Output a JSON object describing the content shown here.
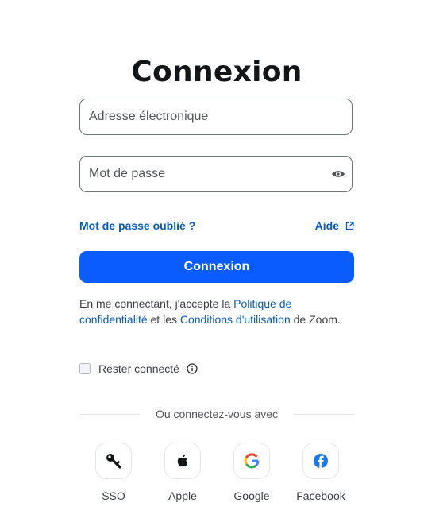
{
  "page": {
    "title": "Connexion"
  },
  "form": {
    "email_placeholder": "Adresse électronique",
    "password_placeholder": "Mot de passe",
    "forgot_password": "Mot de passe oublié ?",
    "help": "Aide",
    "submit_label": "Connexion"
  },
  "terms": {
    "prefix": "En me connectant, j'accepte la ",
    "privacy_link": "Politique de confidentialité",
    "middle": " et les ",
    "conditions_link": "Conditions d'utilisation",
    "suffix": " de Zoom."
  },
  "remember": {
    "label": "Rester connecté",
    "checked": false
  },
  "divider": {
    "text": "Ou connectez-vous avec"
  },
  "social": [
    {
      "label": "SSO",
      "icon": "key-icon"
    },
    {
      "label": "Apple",
      "icon": "apple-icon"
    },
    {
      "label": "Google",
      "icon": "google-icon"
    },
    {
      "label": "Facebook",
      "icon": "facebook-icon"
    }
  ],
  "colors": {
    "primary": "#0b5cff",
    "link": "#0b5cbf",
    "facebook": "#1877f2"
  }
}
